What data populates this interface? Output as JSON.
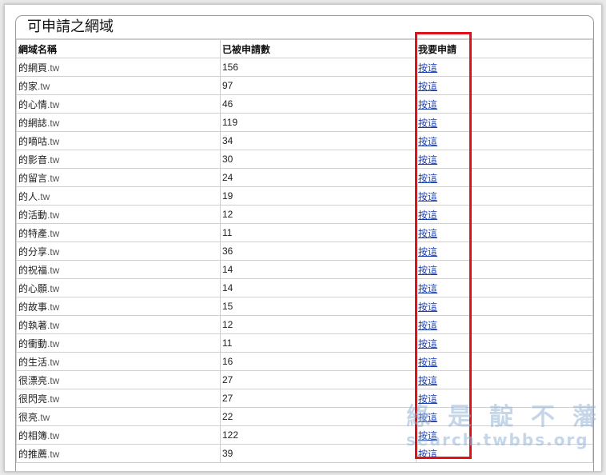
{
  "panel": {
    "title": "可申請之網域"
  },
  "table": {
    "headers": [
      "網域名稱",
      "已被申請數",
      "我要申請"
    ],
    "suffix": ".tw",
    "link_label": "按這",
    "rows": [
      {
        "name": "的網頁",
        "count": "156"
      },
      {
        "name": "的家",
        "count": "97"
      },
      {
        "name": "的心情",
        "count": "46"
      },
      {
        "name": "的網誌",
        "count": "119"
      },
      {
        "name": "的嘀咕",
        "count": "34"
      },
      {
        "name": "的影音",
        "count": "30"
      },
      {
        "name": "的留言",
        "count": "24"
      },
      {
        "name": "的人",
        "count": "19"
      },
      {
        "name": "的活動",
        "count": "12"
      },
      {
        "name": "的特產",
        "count": "11"
      },
      {
        "name": "的分享",
        "count": "36"
      },
      {
        "name": "的祝福",
        "count": "14"
      },
      {
        "name": "的心願",
        "count": "14"
      },
      {
        "name": "的故事",
        "count": "15"
      },
      {
        "name": "的執著",
        "count": "12"
      },
      {
        "name": "的衝動",
        "count": "11"
      },
      {
        "name": "的生活",
        "count": "16"
      },
      {
        "name": "很漂亮",
        "count": "27"
      },
      {
        "name": "很閃亮",
        "count": "27"
      },
      {
        "name": "很亮",
        "count": "22"
      },
      {
        "name": "的相簿",
        "count": "122"
      },
      {
        "name": "的推薦",
        "count": "39"
      }
    ]
  },
  "watermark": {
    "line1": "綠是靛不藩",
    "line2": "search.twbbs.org"
  },
  "colors": {
    "highlight": "#e0111b",
    "link": "#1a3fb0"
  }
}
